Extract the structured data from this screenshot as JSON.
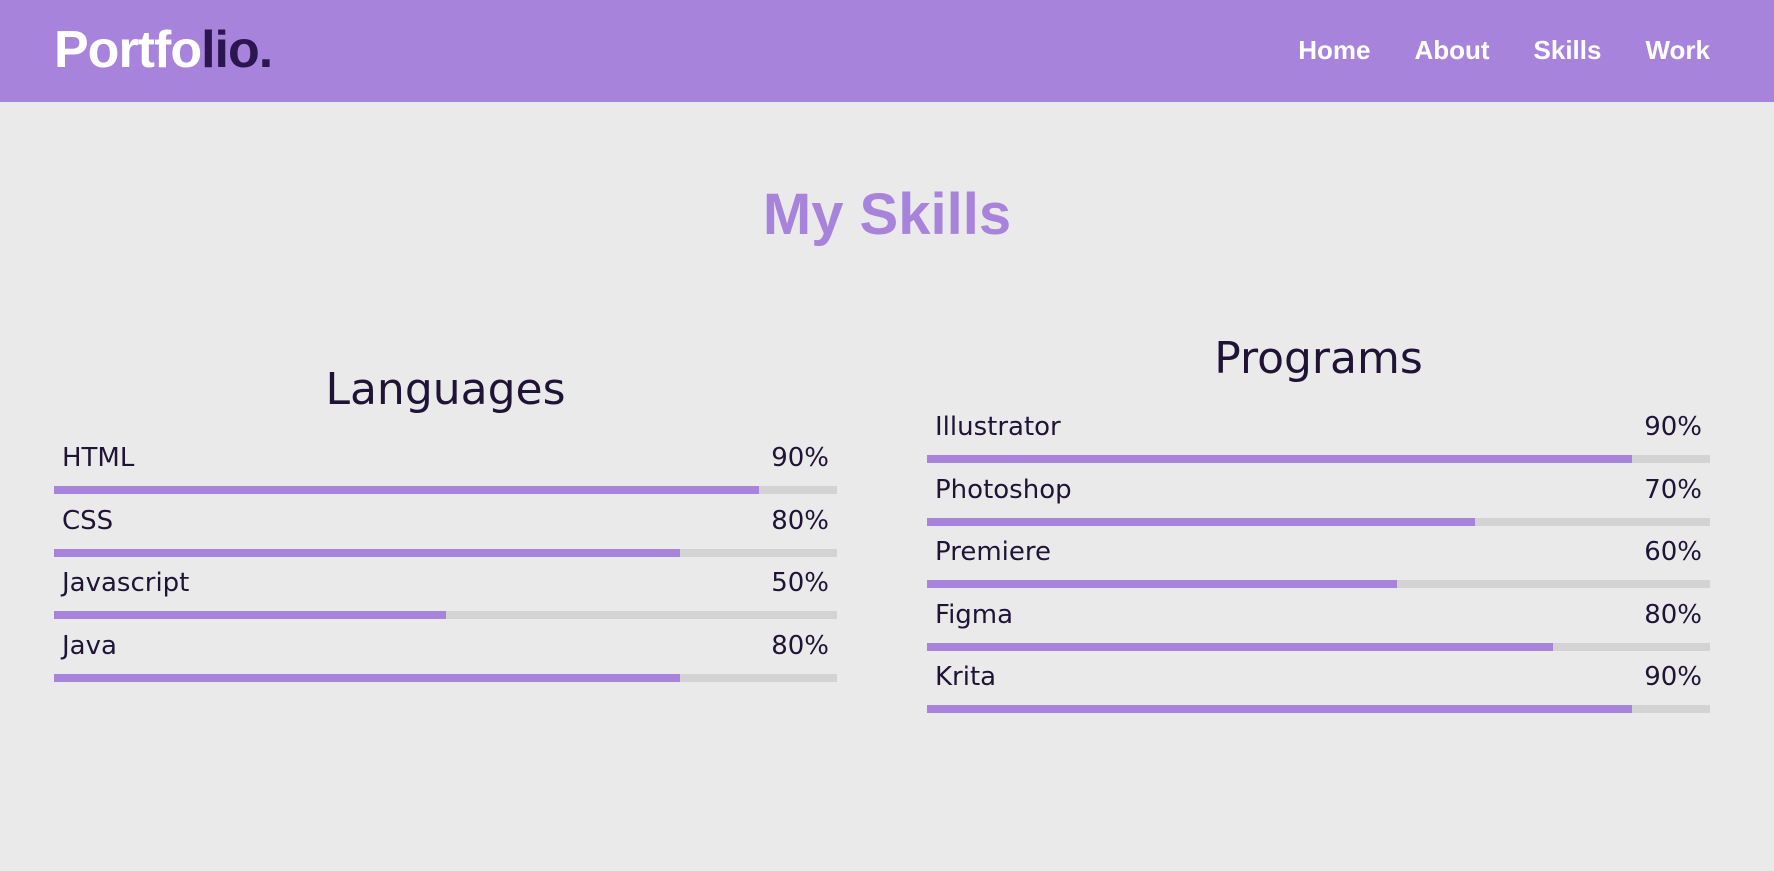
{
  "logo": {
    "part1": "Portfo",
    "part2": "lio."
  },
  "nav": [
    {
      "label": "Home"
    },
    {
      "label": "About"
    },
    {
      "label": "Skills"
    },
    {
      "label": "Work"
    }
  ],
  "page_title": "My Skills",
  "languages": {
    "title": "Languages",
    "items": [
      {
        "name": "HTML",
        "percent": "90%",
        "value": 90
      },
      {
        "name": "CSS",
        "percent": "80%",
        "value": 80
      },
      {
        "name": "Javascript",
        "percent": "50%",
        "value": 50
      },
      {
        "name": "Java",
        "percent": "80%",
        "value": 80
      }
    ]
  },
  "programs": {
    "title": "Programs",
    "items": [
      {
        "name": "Illustrator",
        "percent": "90%",
        "value": 90
      },
      {
        "name": "Photoshop",
        "percent": "70%",
        "value": 70
      },
      {
        "name": "Premiere",
        "percent": "60%",
        "value": 60
      },
      {
        "name": "Figma",
        "percent": "80%",
        "value": 80
      },
      {
        "name": "Krita",
        "percent": "90%",
        "value": 90
      }
    ]
  },
  "colors": {
    "accent": "#a883db",
    "dark": "#2b1650",
    "background": "#eaeaea",
    "track": "#d3d3d3"
  }
}
